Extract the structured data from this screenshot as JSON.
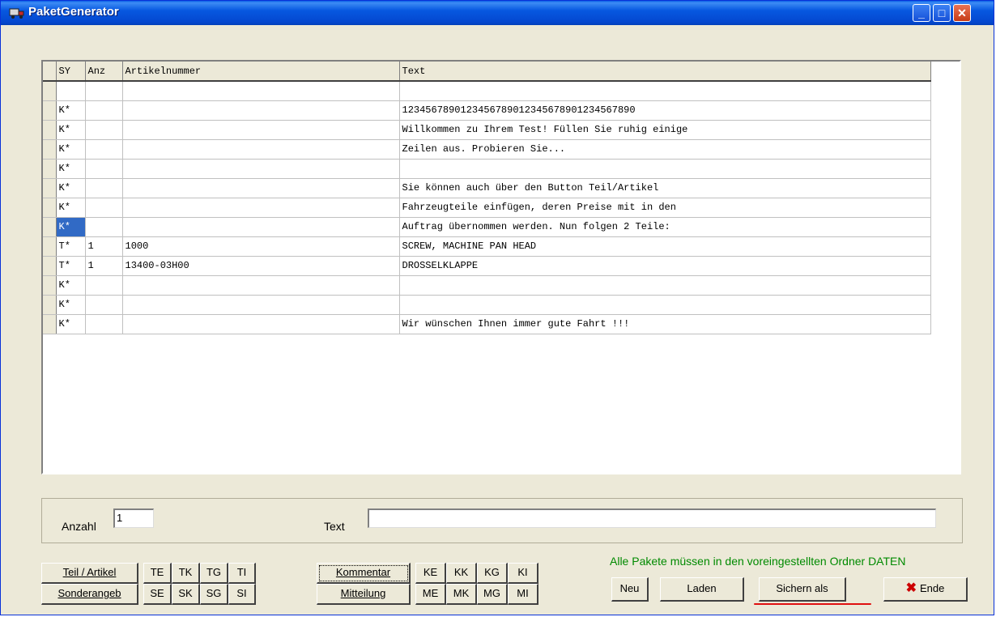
{
  "window": {
    "title": "PaketGenerator",
    "minimize": "_",
    "maximize": "□",
    "close": "✕"
  },
  "grid": {
    "columns": [
      "SY",
      "Anz",
      "Artikelnummer",
      "Text"
    ],
    "rows": [
      [
        "",
        "",
        "",
        ""
      ],
      [
        "K*",
        "",
        "",
        "1234567890123456789012345678901234567890"
      ],
      [
        "K*",
        "",
        "",
        "Willkommen zu Ihrem Test! Füllen Sie ruhig einige"
      ],
      [
        "K*",
        "",
        "",
        "Zeilen aus. Probieren Sie..."
      ],
      [
        "K*",
        "",
        "",
        ""
      ],
      [
        "K*",
        "",
        "",
        "Sie können auch über den Button Teil/Artikel"
      ],
      [
        "K*",
        "",
        "",
        "Fahrzeugteile einfügen, deren Preise mit in den"
      ],
      [
        "K*",
        "",
        "",
        "Auftrag übernommen werden. Nun folgen 2 Teile:"
      ],
      [
        "T*",
        "1",
        "1000",
        "SCREW, MACHINE PAN HEAD"
      ],
      [
        "T*",
        "1",
        "13400-03H00",
        "DROSSELKLAPPE"
      ],
      [
        "K*",
        "",
        "",
        ""
      ],
      [
        "K*",
        "",
        "",
        ""
      ],
      [
        "K*",
        "",
        "",
        "Wir wünschen Ihnen immer gute Fahrt !!!"
      ]
    ],
    "selected_row": 7
  },
  "form": {
    "anzahl_label": "Anzahl",
    "anzahl_value": "1",
    "text_label": "Text",
    "text_value": ""
  },
  "buttons": {
    "teil_artikel": "Teil / Artikel",
    "sonderangeb": "Sonderangeb",
    "kommentar": "Kommentar",
    "mitteilung": "Mitteilung",
    "te": "TE",
    "tk": "TK",
    "tg": "TG",
    "ti": "TI",
    "se": "SE",
    "sk": "SK",
    "sg": "SG",
    "si": "SI",
    "ke": "KE",
    "kk": "KK",
    "kg": "KG",
    "ki": "KI",
    "me": "ME",
    "mk": "MK",
    "mg": "MG",
    "mi": "MI",
    "neu": "Neu",
    "laden": "Laden",
    "sichern": "Sichern als",
    "ende": "Ende"
  },
  "note": "Alle Pakete müssen in den voreingestellten Ordner DATEN",
  "colors": {
    "titlebar": "#0453d8",
    "selection": "#316ac5",
    "note": "#008a00",
    "close_x": "#cc0000"
  },
  "icons": {
    "app": "truck-icon",
    "ende": "x-mark-icon"
  }
}
